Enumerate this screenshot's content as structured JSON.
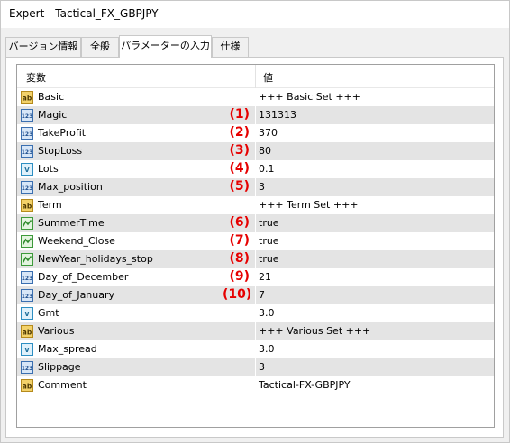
{
  "window": {
    "title": "Expert - Tactical_FX_GBPJPY"
  },
  "tabs": [
    {
      "label": "バージョン情報",
      "active": false
    },
    {
      "label": "全般",
      "active": false
    },
    {
      "label": "パラメーターの入力",
      "active": true
    },
    {
      "label": "仕様",
      "active": false
    }
  ],
  "grid": {
    "columns": {
      "variable": "変数",
      "value": "値"
    },
    "rows": [
      {
        "icon": "string-icon",
        "name": "Basic",
        "value": "+++ Basic Set +++",
        "marker": "",
        "shaded": false
      },
      {
        "icon": "integer-icon",
        "name": "Magic",
        "value": "131313",
        "marker": "(1)",
        "shaded": true
      },
      {
        "icon": "integer-icon",
        "name": "TakeProfit",
        "value": "370",
        "marker": "(2)",
        "shaded": false
      },
      {
        "icon": "integer-icon",
        "name": "StopLoss",
        "value": "80",
        "marker": "(3)",
        "shaded": true
      },
      {
        "icon": "double-icon",
        "name": "Lots",
        "value": "0.1",
        "marker": "(4)",
        "shaded": false
      },
      {
        "icon": "integer-icon",
        "name": "Max_position",
        "value": "3",
        "marker": "(5)",
        "shaded": true
      },
      {
        "icon": "string-icon",
        "name": "Term",
        "value": "+++ Term Set +++",
        "marker": "",
        "shaded": false
      },
      {
        "icon": "bool-icon",
        "name": "SummerTime",
        "value": "true",
        "marker": "(6)",
        "shaded": true
      },
      {
        "icon": "bool-icon",
        "name": "Weekend_Close",
        "value": "true",
        "marker": "(7)",
        "shaded": false
      },
      {
        "icon": "bool-icon",
        "name": "NewYear_holidays_stop",
        "value": "true",
        "marker": "(8)",
        "shaded": true
      },
      {
        "icon": "integer-icon",
        "name": "Day_of_December",
        "value": "21",
        "marker": "(9)",
        "shaded": false
      },
      {
        "icon": "integer-icon",
        "name": "Day_of_January",
        "value": "7",
        "marker": "(10)",
        "shaded": true
      },
      {
        "icon": "double-icon",
        "name": "Gmt",
        "value": "3.0",
        "marker": "",
        "shaded": false
      },
      {
        "icon": "string-icon",
        "name": "Various",
        "value": "+++ Various Set +++",
        "marker": "",
        "shaded": true
      },
      {
        "icon": "double-icon",
        "name": "Max_spread",
        "value": "3.0",
        "marker": "",
        "shaded": false
      },
      {
        "icon": "integer-icon",
        "name": "Slippage",
        "value": "3",
        "marker": "",
        "shaded": true
      },
      {
        "icon": "string-icon",
        "name": "Comment",
        "value": "Tactical-FX-GBPJPY",
        "marker": "",
        "shaded": false
      }
    ]
  },
  "colors": {
    "marker": "#e60000",
    "row_shade": "#e4e4e4"
  }
}
